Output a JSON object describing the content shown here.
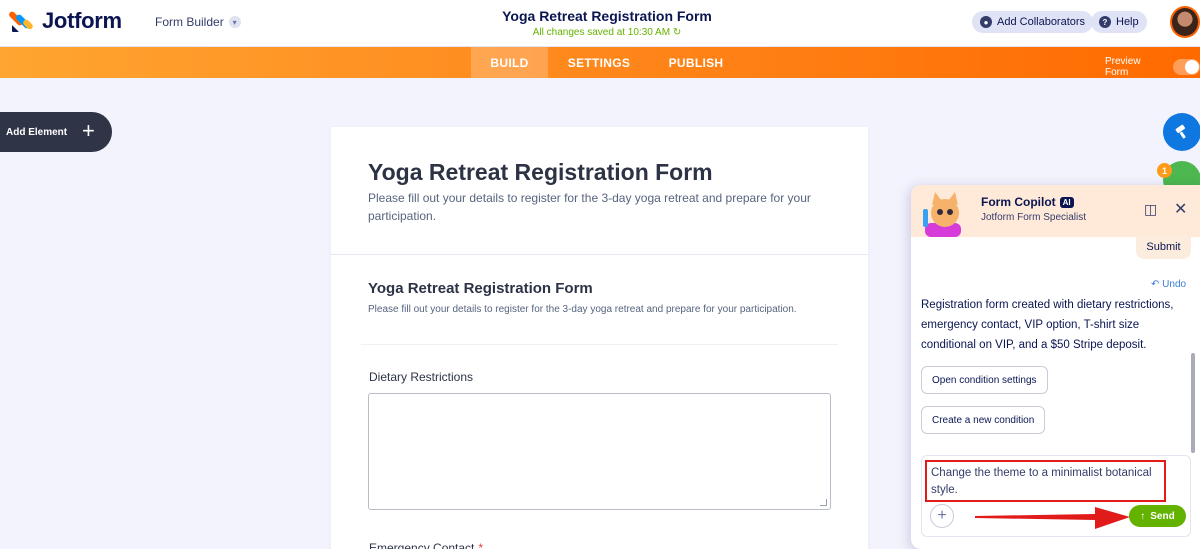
{
  "header": {
    "brand": "Jotform",
    "builder_label": "Form Builder",
    "form_title": "Yoga Retreat Registration Form",
    "save_status": "All changes saved at 10:30 AM",
    "add_collaborators": "Add Collaborators",
    "help": "Help"
  },
  "nav": {
    "tabs": [
      "BUILD",
      "SETTINGS",
      "PUBLISH"
    ],
    "preview_label": "Preview Form"
  },
  "add_element": "Add Element",
  "form": {
    "title": "Yoga Retreat Registration Form",
    "description": "Please fill out your details to register for the 3-day yoga retreat and prepare for your participation.",
    "section_title": "Yoga Retreat Registration Form",
    "section_description": "Please fill out your details to register for the 3-day yoga retreat and prepare for your participation.",
    "field1_label": "Dietary Restrictions",
    "field2_label": "Emergency Contact",
    "field2_required": "*"
  },
  "side_badge": "1",
  "copilot": {
    "name": "Form Copilot",
    "ai_badge": "AI",
    "subtitle": "Jotform Form Specialist",
    "submit_bubble": "Submit",
    "undo": "Undo",
    "message": "Registration form created with dietary restrictions, emergency contact, VIP option, T-shirt size conditional on VIP, and a $50 Stripe deposit.",
    "suggestion_1": "Open condition settings",
    "suggestion_2": "Create a new condition",
    "input_value": "Change the theme to a minimalist botanical style.",
    "send_label": "Send"
  },
  "colors": {
    "accent_orange": "#ff6100",
    "send_green": "#64b200",
    "highlight_red": "#e11a1a"
  }
}
